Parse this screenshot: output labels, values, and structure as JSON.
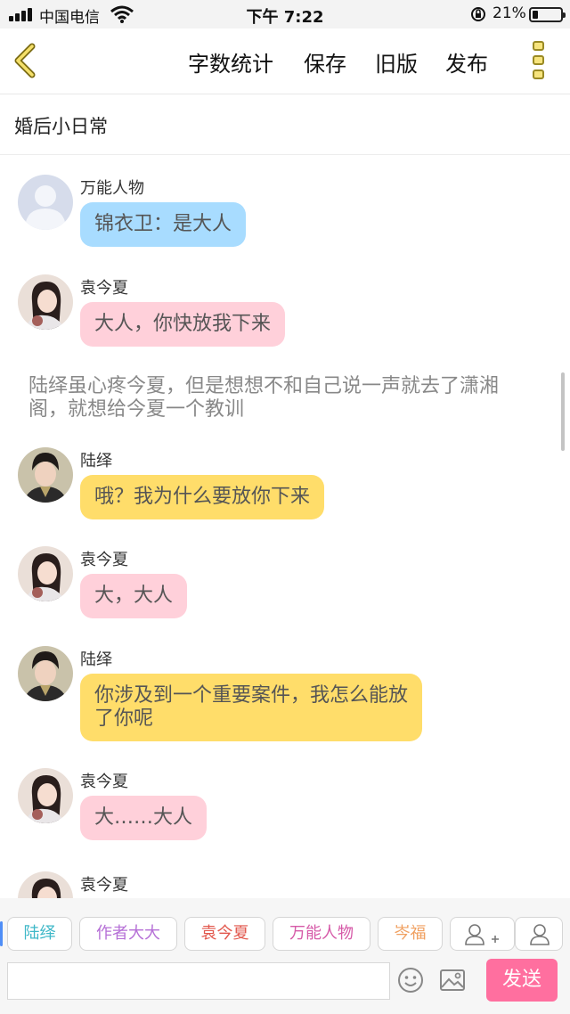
{
  "status_bar": {
    "carrier": "中国电信",
    "time": "下午 7:22",
    "battery_percent": "21%",
    "battery_level": 0.21
  },
  "nav": {
    "back_icon": "chevron-left-icon",
    "actions": [
      {
        "label": "字数统计"
      },
      {
        "label": "保存"
      },
      {
        "label": "旧版"
      },
      {
        "label": "发布"
      }
    ],
    "more_icon": "more-vertical-icon"
  },
  "story": {
    "title": "婚后小日常"
  },
  "messages": [
    {
      "type": "bubble",
      "sender": "万能人物",
      "text": "锦衣卫：是大人",
      "color": "#a8dcff",
      "avatar": "default-user-avatar"
    },
    {
      "type": "bubble",
      "sender": "袁今夏",
      "text": "大人，你快放我下来",
      "color": "#ffd0da",
      "avatar": "yuan-jinxia-avatar"
    },
    {
      "type": "narration",
      "text": "陆绎虽心疼今夏，但是想想不和自己说一声就去了潇湘阁，就想给今夏一个教训"
    },
    {
      "type": "bubble",
      "sender": "陆绎",
      "text": "哦？我为什么要放你下来",
      "color": "#ffdd6a",
      "avatar": "lu-yi-avatar"
    },
    {
      "type": "bubble",
      "sender": "袁今夏",
      "text": "大，大人",
      "color": "#ffd0da",
      "avatar": "yuan-jinxia-avatar"
    },
    {
      "type": "bubble",
      "sender": "陆绎",
      "text": "你涉及到一个重要案件，我怎么能放了你呢",
      "color": "#ffdd6a",
      "avatar": "lu-yi-avatar"
    },
    {
      "type": "bubble",
      "sender": "袁今夏",
      "text": "大……大人",
      "color": "#ffd0da",
      "avatar": "yuan-jinxia-avatar"
    },
    {
      "type": "bubble",
      "sender": "袁今夏",
      "text": "",
      "color": "#ffd0da",
      "avatar": "yuan-jinxia-avatar"
    }
  ],
  "characters": [
    {
      "name": "陆绎",
      "color": "#3fb8c8"
    },
    {
      "name": "作者大大",
      "color": "#b56fd6"
    },
    {
      "name": "袁今夏",
      "color": "#e2574c"
    },
    {
      "name": "万能人物",
      "color": "#d65aa8"
    },
    {
      "name": "岑福",
      "color": "#f0a060"
    }
  ],
  "character_tools": [
    {
      "icon": "add-character-icon"
    },
    {
      "icon": "character-manage-icon"
    }
  ],
  "composer": {
    "placeholder": "",
    "value": "",
    "emoji_icon": "emoji-icon",
    "image_icon": "image-icon",
    "send_label": "发送"
  }
}
